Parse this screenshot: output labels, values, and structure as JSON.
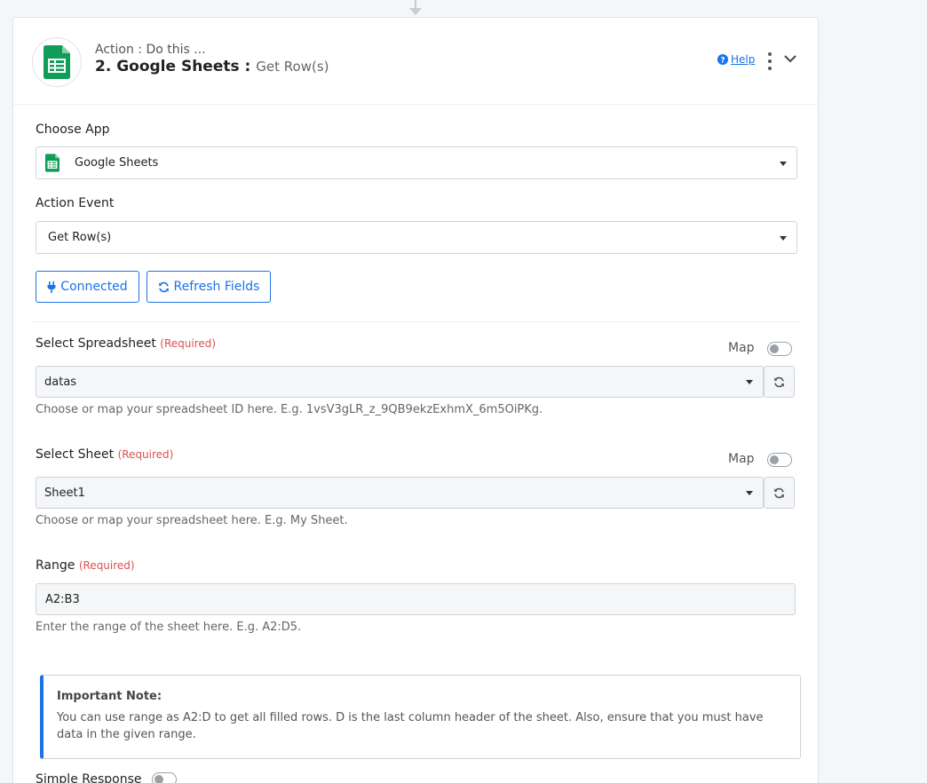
{
  "header": {
    "subtitle": "Action : Do this ...",
    "title": "2. Google Sheets :",
    "event": "Get Row(s)",
    "help_label": "Help"
  },
  "choose_app": {
    "label": "Choose App",
    "value": "Google Sheets"
  },
  "action_event": {
    "label": "Action Event",
    "value": "Get Row(s)"
  },
  "buttons": {
    "connected": "Connected",
    "refresh_fields": "Refresh Fields"
  },
  "spreadsheet": {
    "label": "Select Spreadsheet",
    "required": "(Required)",
    "map_label": "Map",
    "value": "datas",
    "help": "Choose or map your spreadsheet ID here. E.g. 1vsV3gLR_z_9QB9ekzExhmX_6m5OiPKg."
  },
  "sheet": {
    "label": "Select Sheet",
    "required": "(Required)",
    "map_label": "Map",
    "value": "Sheet1",
    "help": "Choose or map your spreadsheet here. E.g. My Sheet."
  },
  "range": {
    "label": "Range",
    "required": "(Required)",
    "value": "A2:B3",
    "help": "Enter the range of the sheet here. E.g. A2:D5."
  },
  "note": {
    "title": "Important Note:",
    "body": "You can use range as A2:D to get all filled rows. D is the last column header of the sheet. Also, ensure that you must have data in the given range."
  },
  "simple_response": {
    "label": "Simple Response"
  },
  "colors": {
    "accent": "#1a73e8",
    "required": "#d9534f",
    "sheets_green": "#0f9d58"
  }
}
